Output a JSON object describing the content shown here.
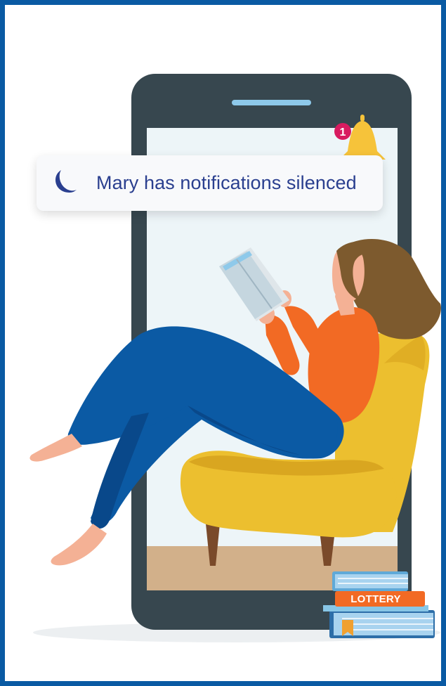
{
  "notification": {
    "text": "Mary has notifications silenced",
    "icon": "crescent-moon-icon",
    "badge_count": "1",
    "badge_icon": "bell-icon"
  },
  "book_label": "LOTTERY",
  "colors": {
    "frame_border": "#0a5aa3",
    "phone_body": "#37474f",
    "phone_screen": "#edf5f8",
    "floor": "#d2b08a",
    "chair": "#ecbf2f",
    "pants": "#0b5aa4",
    "shirt": "#f26a24",
    "hair": "#7d5a2e",
    "moon": "#2a3f8f",
    "bell": "#f6c33a",
    "badge": "#d81b60",
    "book_blue": "#88c6e6",
    "book_orange": "#f26a24"
  }
}
